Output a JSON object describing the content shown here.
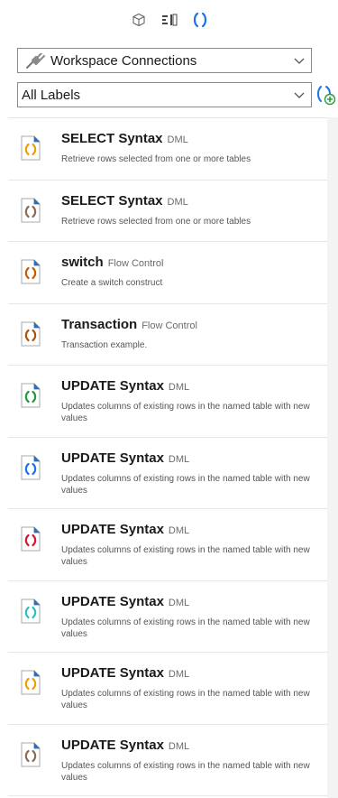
{
  "toolbar": {
    "icons": [
      "cube-icon",
      "layout-icon",
      "braces-icon"
    ],
    "accent": "#1a73e8"
  },
  "connection_select": {
    "value": "Workspace Connections"
  },
  "labels_select": {
    "value": "All Labels"
  },
  "snippets": [
    {
      "title": "SELECT Syntax",
      "category": "DML",
      "description": "Retrieve rows selected from one or more tables",
      "color": "#f0a000"
    },
    {
      "title": "SELECT Syntax",
      "category": "DML",
      "description": "Retrieve rows selected from one or more tables",
      "color": "#8a6a55"
    },
    {
      "title": "switch",
      "category": "Flow Control",
      "description": "Create a switch construct",
      "color": "#c85a00"
    },
    {
      "title": "Transaction",
      "category": "Flow Control",
      "description": "Transaction example.",
      "color": "#b35000"
    },
    {
      "title": "UPDATE Syntax",
      "category": "DML",
      "description": "Updates columns of existing rows in the named table with new values",
      "color": "#1f9a3a"
    },
    {
      "title": "UPDATE Syntax",
      "category": "DML",
      "description": "Updates columns of existing rows in the named table with new values",
      "color": "#1a73e8"
    },
    {
      "title": "UPDATE Syntax",
      "category": "DML",
      "description": "Updates columns of existing rows in the named table with new values",
      "color": "#d4142a"
    },
    {
      "title": "UPDATE Syntax",
      "category": "DML",
      "description": "Updates columns of existing rows in the named table with new values",
      "color": "#2ac0c0"
    },
    {
      "title": "UPDATE Syntax",
      "category": "DML",
      "description": "Updates columns of existing rows in the named table with new values",
      "color": "#f0a000"
    },
    {
      "title": "UPDATE Syntax",
      "category": "DML",
      "description": "Updates columns of existing rows in the named table with new values",
      "color": "#8a6a55"
    }
  ]
}
